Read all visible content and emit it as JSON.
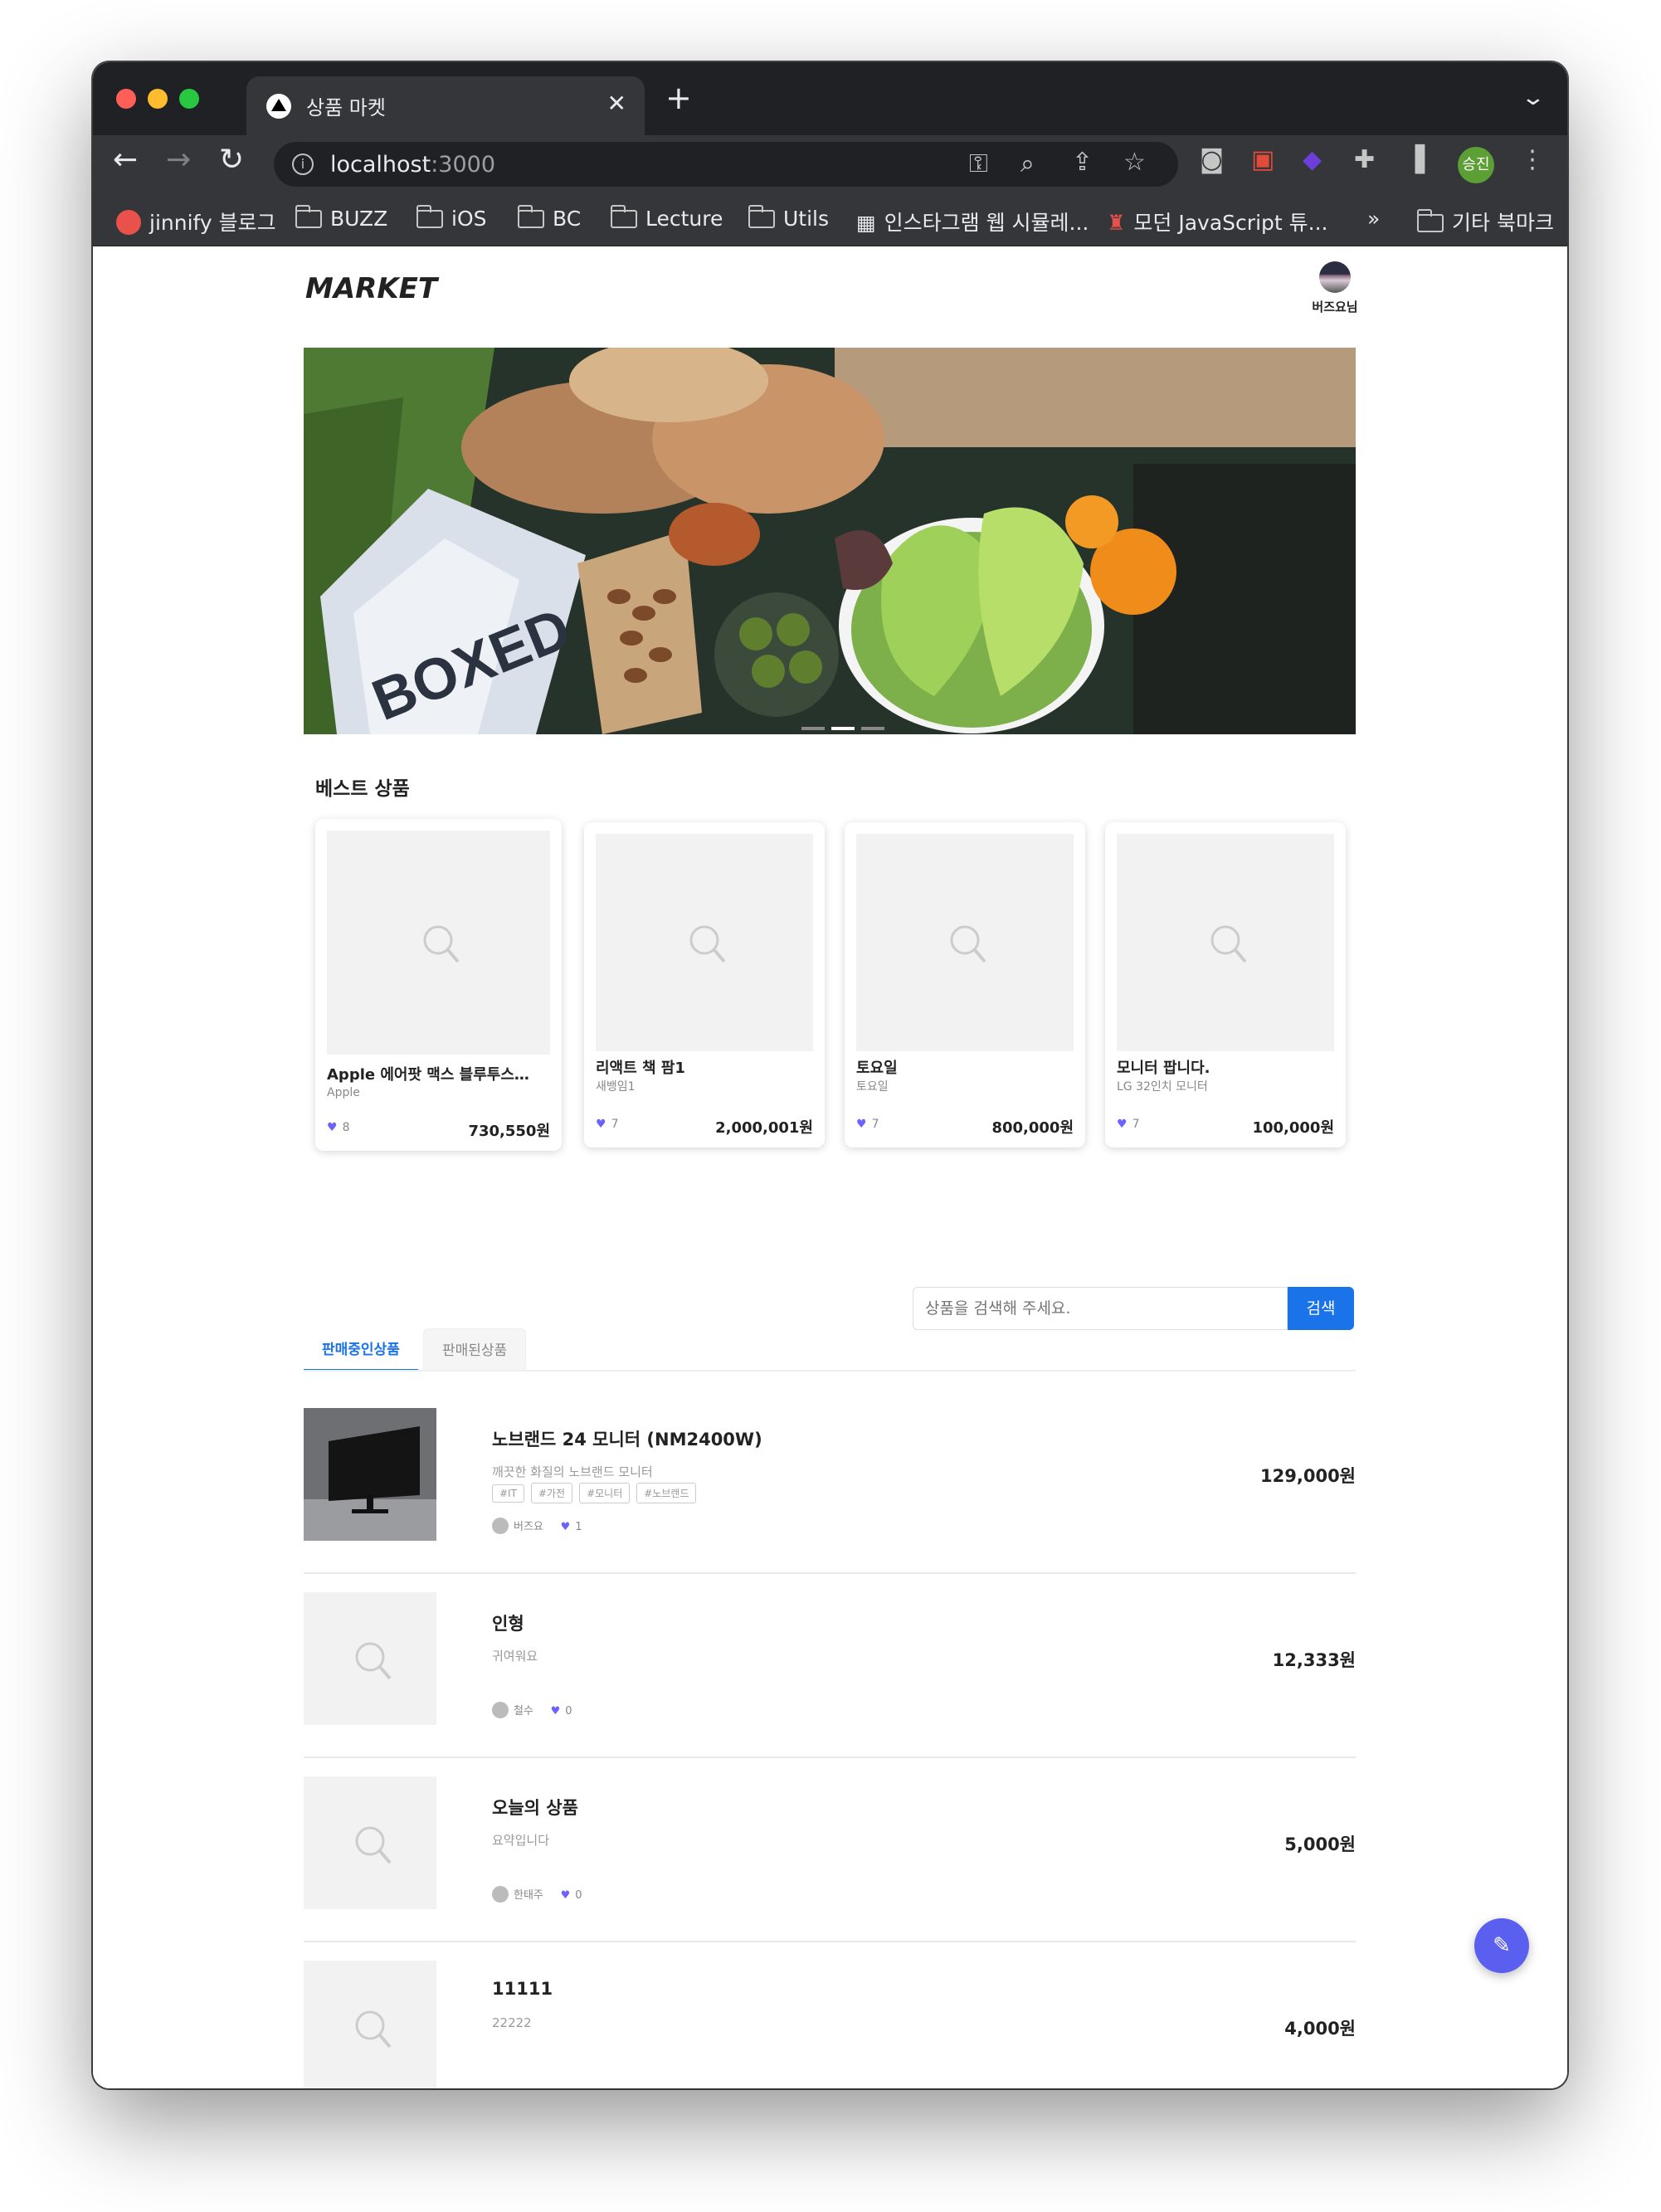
{
  "browser": {
    "tab_title": "상품 마켓",
    "url_host": "localhost",
    "url_port": ":3000",
    "profile_chip": "승진",
    "bookmarks": [
      "jinnify 블로그",
      "BUZZ",
      "iOS",
      "BC",
      "Lecture",
      "Utils",
      "인스타그램 웹 시뮬레...",
      "모던 JavaScript 튜...",
      "»",
      "기타 북마크"
    ]
  },
  "header": {
    "logo": "MARKET",
    "user_name": "버즈요님"
  },
  "best": {
    "title": "베스트 상품",
    "items": [
      {
        "name": "Apple 에어팟 맥스 블루투스헤...",
        "seller": "Apple",
        "likes": "8",
        "price": "730,550원"
      },
      {
        "name": "리액트 책 팜1",
        "seller": "새뱅임1",
        "likes": "7",
        "price": "2,000,001원"
      },
      {
        "name": "토요일",
        "seller": "토요일",
        "likes": "7",
        "price": "800,000원"
      },
      {
        "name": "모니터 팝니다.",
        "seller": "LG 32인치 모니터",
        "likes": "7",
        "price": "100,000원"
      }
    ]
  },
  "search": {
    "placeholder": "상품을 검색해 주세요.",
    "button": "검색"
  },
  "tabs": {
    "selling": "판매중인상품",
    "sold": "판매된상품"
  },
  "list": [
    {
      "title": "노브랜드 24 모니터 (NM2400W)",
      "desc": "깨끗한 화질의 노브랜드 모니터",
      "tags": [
        "#IT",
        "#가전",
        "#모니터",
        "#노브랜드"
      ],
      "user": "버즈요",
      "likes": "1",
      "price": "129,000원"
    },
    {
      "title": "인형",
      "desc": "귀여워요",
      "user": "철수",
      "likes": "0",
      "price": "12,333원"
    },
    {
      "title": "오늘의 상품",
      "desc": "요약입니다",
      "user": "한태주",
      "likes": "0",
      "price": "5,000원"
    },
    {
      "title": "11111",
      "desc": "22222",
      "price": "4,000원"
    }
  ],
  "colors": {
    "accent": "#1a73e8",
    "heart": "#6c63ff",
    "fab": "#5b5ff0"
  }
}
